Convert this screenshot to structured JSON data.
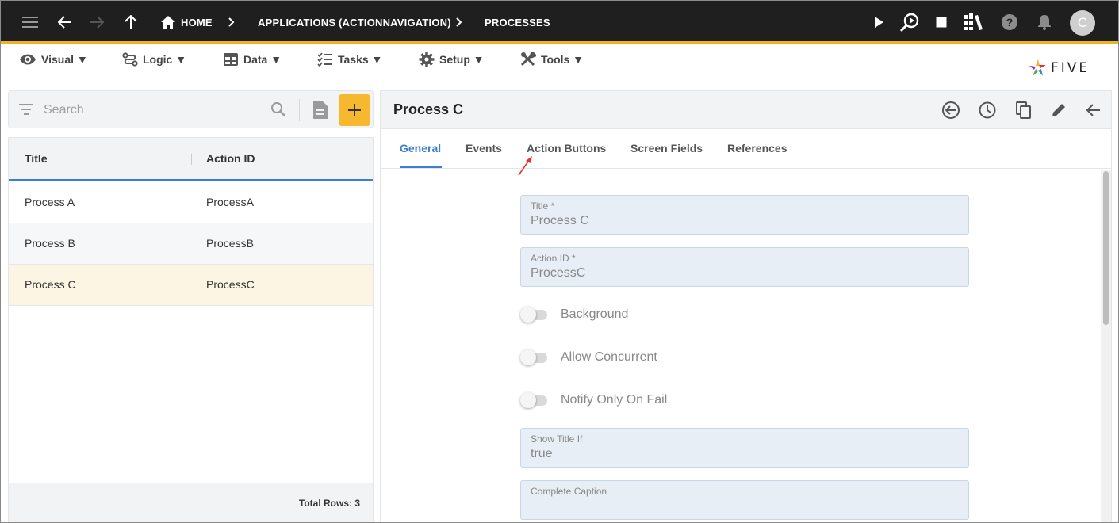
{
  "topbar": {
    "breadcrumb": [
      "HOME",
      "APPLICATIONS (ACTIONNAVIGATION)",
      "PROCESSES"
    ],
    "avatar_initial": "C",
    "icons": [
      "menu-icon",
      "back-arrow-icon",
      "forward-arrow-icon",
      "up-arrow-icon",
      "home-icon",
      "play-icon",
      "debug-search-icon",
      "stop-icon",
      "library-icon",
      "help-icon",
      "bell-icon"
    ]
  },
  "menu": {
    "items": [
      {
        "label": "Visual ▼",
        "icon": "eye-icon"
      },
      {
        "label": "Logic ▼",
        "icon": "flow-icon"
      },
      {
        "label": "Data ▼",
        "icon": "table-icon"
      },
      {
        "label": "Tasks ▼",
        "icon": "checklist-icon"
      },
      {
        "label": "Setup ▼",
        "icon": "gear-icon"
      },
      {
        "label": "Tools ▼",
        "icon": "tools-icon"
      }
    ],
    "logo_text": "FIVE"
  },
  "list": {
    "search_placeholder": "Search",
    "columns": [
      "Title",
      "Action ID"
    ],
    "rows": [
      {
        "title": "Process A",
        "action_id": "ProcessA"
      },
      {
        "title": "Process B",
        "action_id": "ProcessB"
      },
      {
        "title": "Process C",
        "action_id": "ProcessC",
        "selected": true
      }
    ],
    "footer": "Total Rows: 3"
  },
  "detail": {
    "title": "Process C",
    "tabs": [
      "General",
      "Events",
      "Action Buttons",
      "Screen Fields",
      "References"
    ],
    "active_tab": "General",
    "fields": {
      "title_label": "Title *",
      "title_value": "Process C",
      "action_id_label": "Action ID *",
      "action_id_value": "ProcessC",
      "show_title_if_label": "Show Title If",
      "show_title_if_value": "true",
      "complete_caption_label": "Complete Caption",
      "complete_caption_value": ""
    },
    "toggles": [
      {
        "label": "Background",
        "on": false
      },
      {
        "label": "Allow Concurrent",
        "on": false
      },
      {
        "label": "Notify Only On Fail",
        "on": false
      }
    ]
  },
  "colors": {
    "topbar_bg": "#1f1f1f",
    "accent_orange": "#f0b323",
    "add_button": "#f5b82e",
    "active_blue": "#3c7fd1",
    "selected_row": "#fdf5e4",
    "annotation_arrow": "#e5322d"
  }
}
